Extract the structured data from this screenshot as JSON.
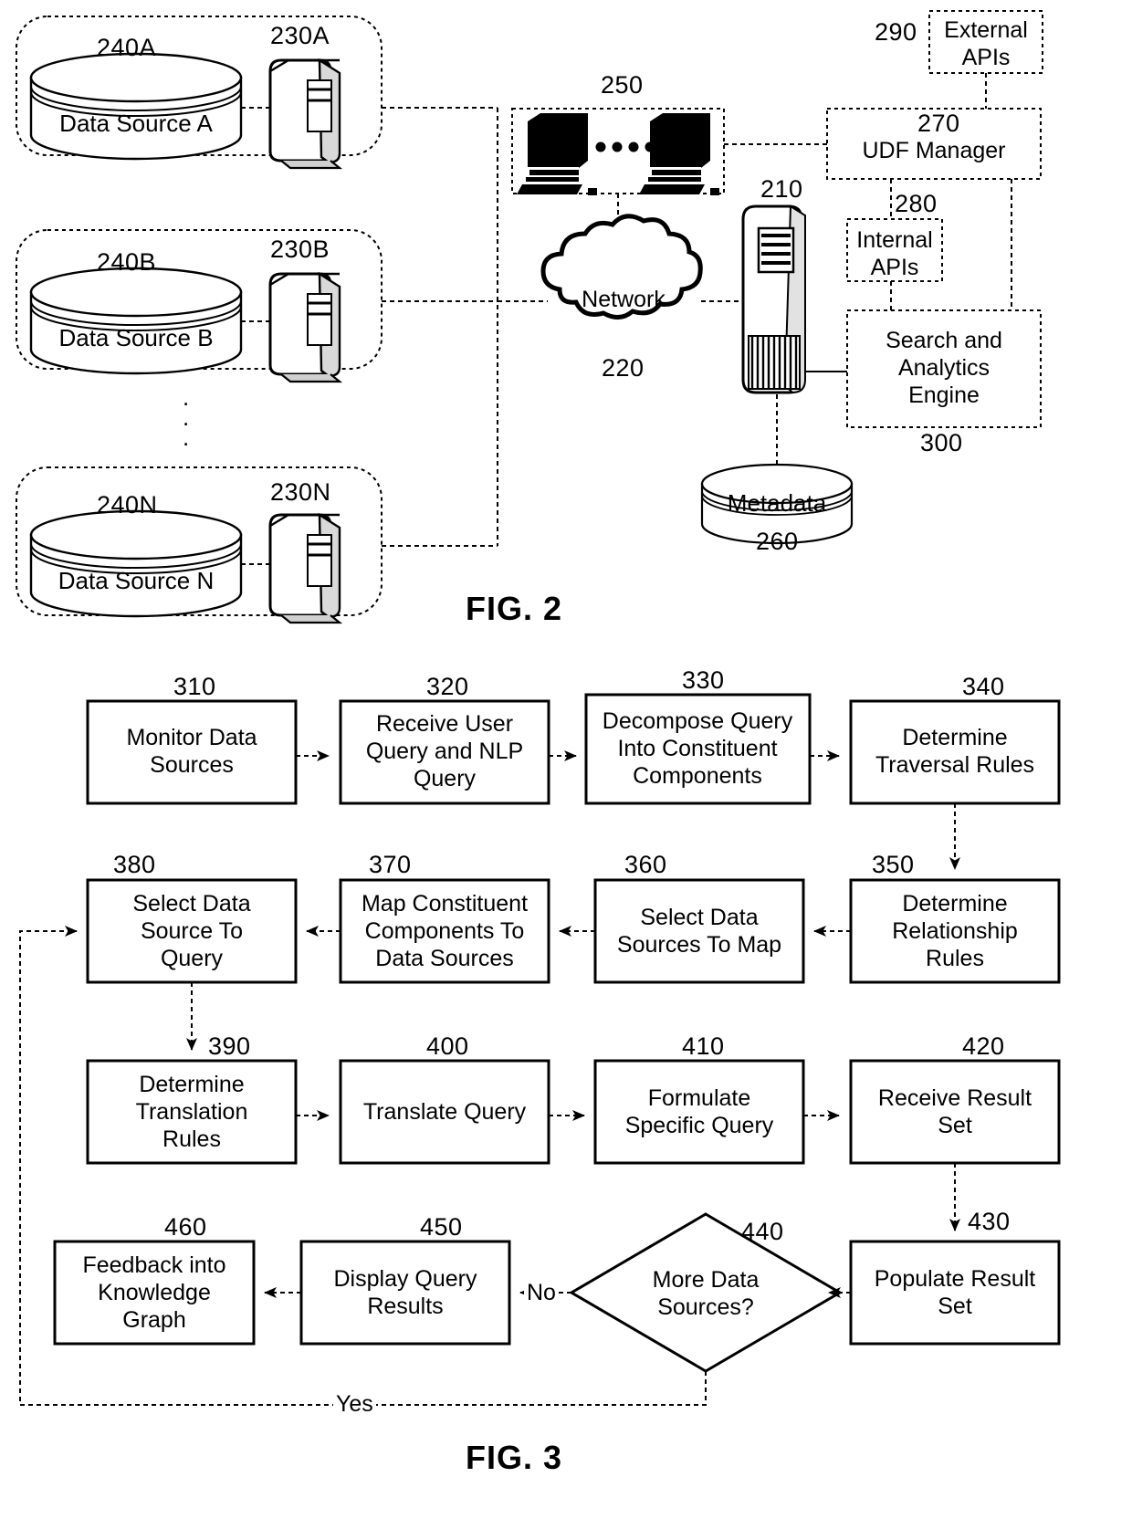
{
  "figures": [
    {
      "id": "fig2",
      "title": "FIG. 2"
    },
    {
      "id": "fig3",
      "title": "FIG. 3"
    }
  ],
  "fig2": {
    "title": "FIG. 2",
    "data_source_groups": [
      {
        "db_ref": "240A",
        "server_ref": "230A",
        "db_label": "Data Source A"
      },
      {
        "db_ref": "240B",
        "server_ref": "230B",
        "db_label": "Data Source B"
      },
      {
        "db_ref": "240N",
        "server_ref": "230N",
        "db_label": "Data Source N"
      }
    ],
    "vertical_ellipsis": ".\n.\n.",
    "clients": {
      "ref": "250",
      "ellipsis": "••••"
    },
    "network": {
      "ref": "220",
      "label": "Network"
    },
    "main_server": {
      "ref": "210"
    },
    "metadata": {
      "ref": "260",
      "label": "Metadata"
    },
    "udf_manager": {
      "ref": "270",
      "label": "UDF Manager"
    },
    "external_apis": {
      "ref": "290",
      "label": "External\nAPIs"
    },
    "internal_apis": {
      "ref": "280",
      "label": "Internal\nAPIs"
    },
    "search_engine": {
      "ref": "300",
      "label": "Search and\nAnalytics\nEngine"
    }
  },
  "fig3": {
    "title": "FIG. 3",
    "steps": [
      {
        "ref": "310",
        "label": "Monitor Data\nSources"
      },
      {
        "ref": "320",
        "label": "Receive User\nQuery and NLP\nQuery"
      },
      {
        "ref": "330",
        "label": "Decompose Query\nInto Constituent\nComponents"
      },
      {
        "ref": "340",
        "label": "Determine\nTraversal Rules"
      },
      {
        "ref": "350",
        "label": "Determine\nRelationship\nRules"
      },
      {
        "ref": "360",
        "label": "Select Data\nSources To Map"
      },
      {
        "ref": "370",
        "label": "Map Constituent\nComponents To\nData Sources"
      },
      {
        "ref": "380",
        "label": "Select Data\nSource To\nQuery"
      },
      {
        "ref": "390",
        "label": "Determine\nTranslation\nRules"
      },
      {
        "ref": "400",
        "label": "Translate Query"
      },
      {
        "ref": "410",
        "label": "Formulate\nSpecific Query"
      },
      {
        "ref": "420",
        "label": "Receive Result\nSet"
      },
      {
        "ref": "430",
        "label": "Populate Result\nSet"
      },
      {
        "ref": "450",
        "label": "Display Query\nResults"
      },
      {
        "ref": "460",
        "label": "Feedback into\nKnowledge\nGraph"
      }
    ],
    "decision": {
      "ref": "440",
      "label": "More Data\nSources?"
    },
    "branch_no": "No",
    "branch_yes": "Yes"
  }
}
